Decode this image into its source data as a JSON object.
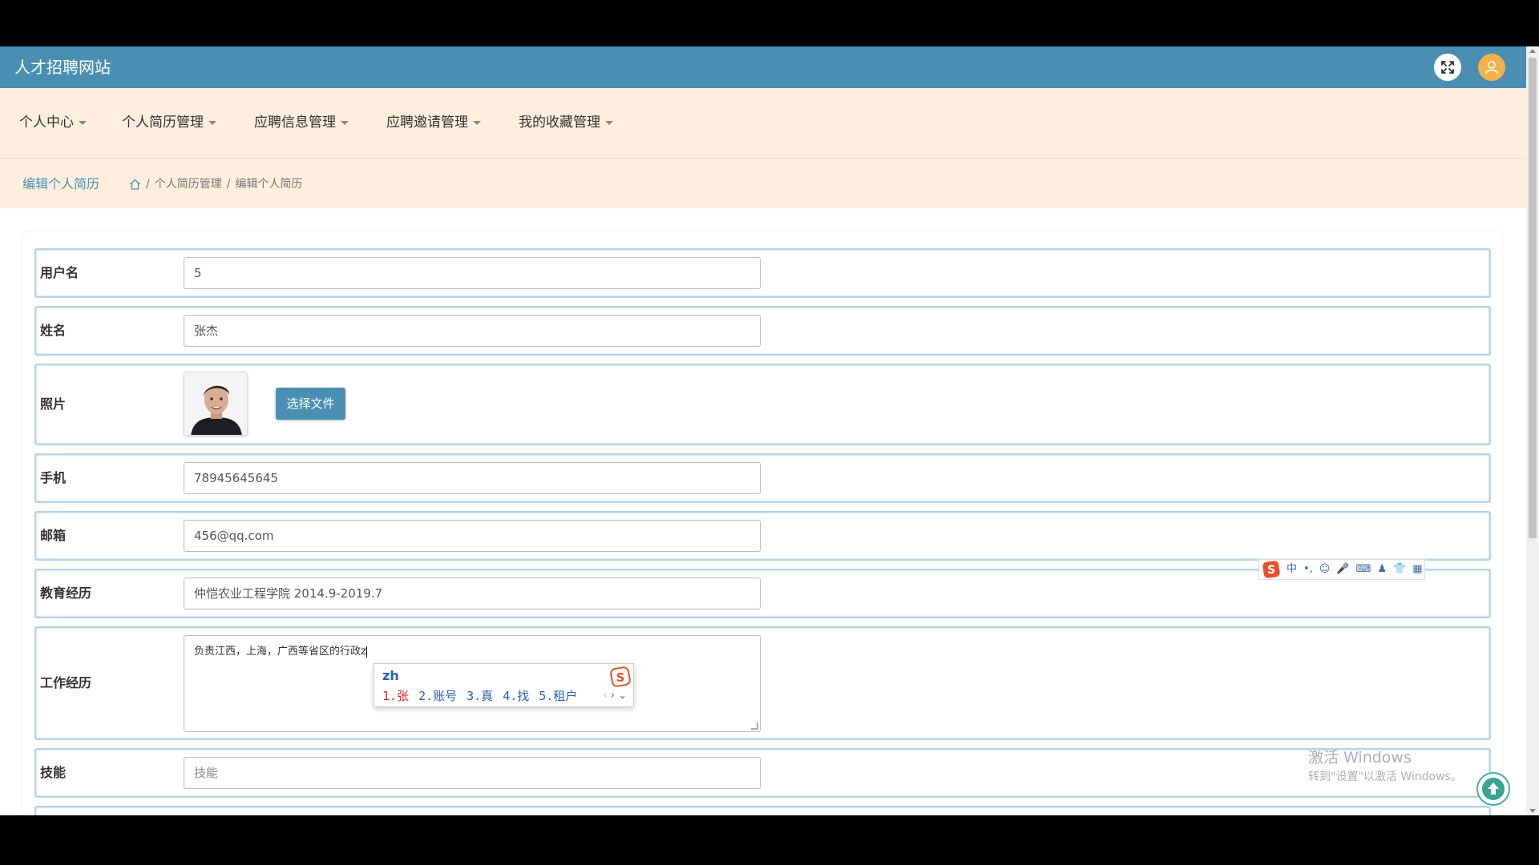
{
  "app": {
    "title": "人才招聘网站"
  },
  "colors": {
    "topbar": "#4a8fb3",
    "nav_bg": "#fdeedd",
    "accent": "#4a8fb3",
    "avatar_bg": "#f3b24b",
    "row_border": "#b6d3e8"
  },
  "header": {
    "fullscreen_icon": "expand-arrows-icon",
    "user_icon": "user-icon"
  },
  "nav": {
    "items": [
      {
        "label": "个人中心"
      },
      {
        "label": "个人简历管理"
      },
      {
        "label": "应聘信息管理"
      },
      {
        "label": "应聘邀请管理"
      },
      {
        "label": "我的收藏管理"
      }
    ]
  },
  "breadcrumb": {
    "title": "编辑个人简历",
    "home_icon": "home-icon",
    "separator": "/",
    "items": [
      "个人简历管理",
      "编辑个人简历"
    ]
  },
  "form": {
    "username": {
      "label": "用户名",
      "value": "5"
    },
    "name": {
      "label": "姓名",
      "value": "张杰"
    },
    "photo": {
      "label": "照片",
      "button": "选择文件"
    },
    "phone": {
      "label": "手机",
      "value": "78945645645"
    },
    "email": {
      "label": "邮箱",
      "value": "456@qq.com"
    },
    "education": {
      "label": "教育经历",
      "value": "仲恺农业工程学院 2014.9-2019.7"
    },
    "work": {
      "label": "工作经历",
      "value": "负责江西，上海，广西等省区的行政z"
    },
    "skills": {
      "label": "技能",
      "placeholder": "技能"
    }
  },
  "ime": {
    "input": "zh",
    "candidates": [
      "1.张",
      "2.账号",
      "3.真",
      "4.找",
      "5.租户"
    ],
    "toolbar": [
      "中",
      "•,",
      "☺",
      "🎤",
      "⌨",
      "♟",
      "👕",
      "▦"
    ]
  },
  "watermark": {
    "line1": "激活 Windows",
    "line2": "转到\"设置\"以激活 Windows。"
  }
}
